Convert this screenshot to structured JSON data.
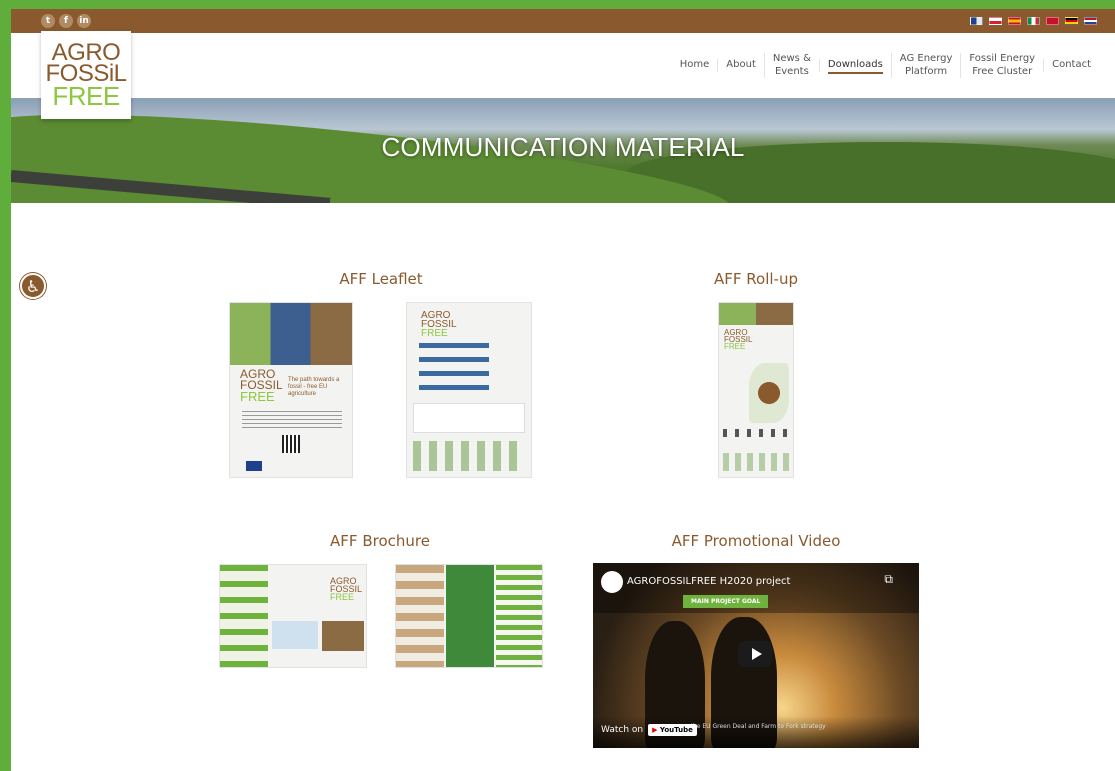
{
  "social": [
    "twitter",
    "facebook",
    "linkedin"
  ],
  "social_glyphs": [
    "t",
    "f",
    "in"
  ],
  "languages": [
    {
      "code": "en",
      "colors": [
        "#1f3f8f",
        "#e6e6e6"
      ]
    },
    {
      "code": "pl",
      "colors": [
        "#ffffff",
        "#d6202f"
      ]
    },
    {
      "code": "es",
      "colors": [
        "#c8102e",
        "#f1bf00"
      ]
    },
    {
      "code": "it",
      "colors": [
        "#009246",
        "#ce2b37"
      ]
    },
    {
      "code": "dk",
      "colors": [
        "#c8102e",
        "#ffffff"
      ]
    },
    {
      "code": "de",
      "colors": [
        "#000000",
        "#dd0000"
      ]
    },
    {
      "code": "nl",
      "colors": [
        "#ae1c28",
        "#21468b"
      ]
    }
  ],
  "logo": {
    "line1": "AGRO",
    "line2": "FOSSiL",
    "line3": "FREE"
  },
  "nav": [
    {
      "label": "Home"
    },
    {
      "label": "About"
    },
    {
      "label": "News &\nEvents"
    },
    {
      "label": "Downloads",
      "active": true
    },
    {
      "label": "AG Energy\nPlatform"
    },
    {
      "label": "Fossil Energy\nFree Cluster"
    },
    {
      "label": "Contact"
    }
  ],
  "hero": {
    "title": "COMMUNICATION MATERIAL"
  },
  "sections": {
    "leaflet": "AFF Leaflet",
    "rollup": "AFF Roll-up",
    "brochure": "AFF Brochure",
    "video": "AFF Promotional Video"
  },
  "thumbs": {
    "leaflet_front": {
      "line1": "AGRO",
      "line2": "FOSSIL",
      "line3": "FREE",
      "tagline": "The path towards a fossil - free EU agriculture"
    },
    "leaflet_back": {
      "line1": "AGRO",
      "line2": "FOSSIL",
      "line3": "FREE"
    },
    "rollup": {
      "line1": "AGRO",
      "line2": "FOSSIL",
      "line3": "FREE"
    },
    "brochure_outer": {
      "line1": "AGRO",
      "line2": "FOSSIL",
      "line3": "FREE"
    }
  },
  "video": {
    "title": "AGROFOSSILFREE H2020 project",
    "badge": "MAIN PROJECT GOAL",
    "watch_on": "Watch on",
    "youtube_label": "YouTube",
    "caption": "... the EU Green Deal and Farm to Fork strategy"
  },
  "colors": {
    "brand_brown": "#8a5a2e",
    "brand_green": "#8dc63f",
    "frame_green": "#5fae3c"
  }
}
